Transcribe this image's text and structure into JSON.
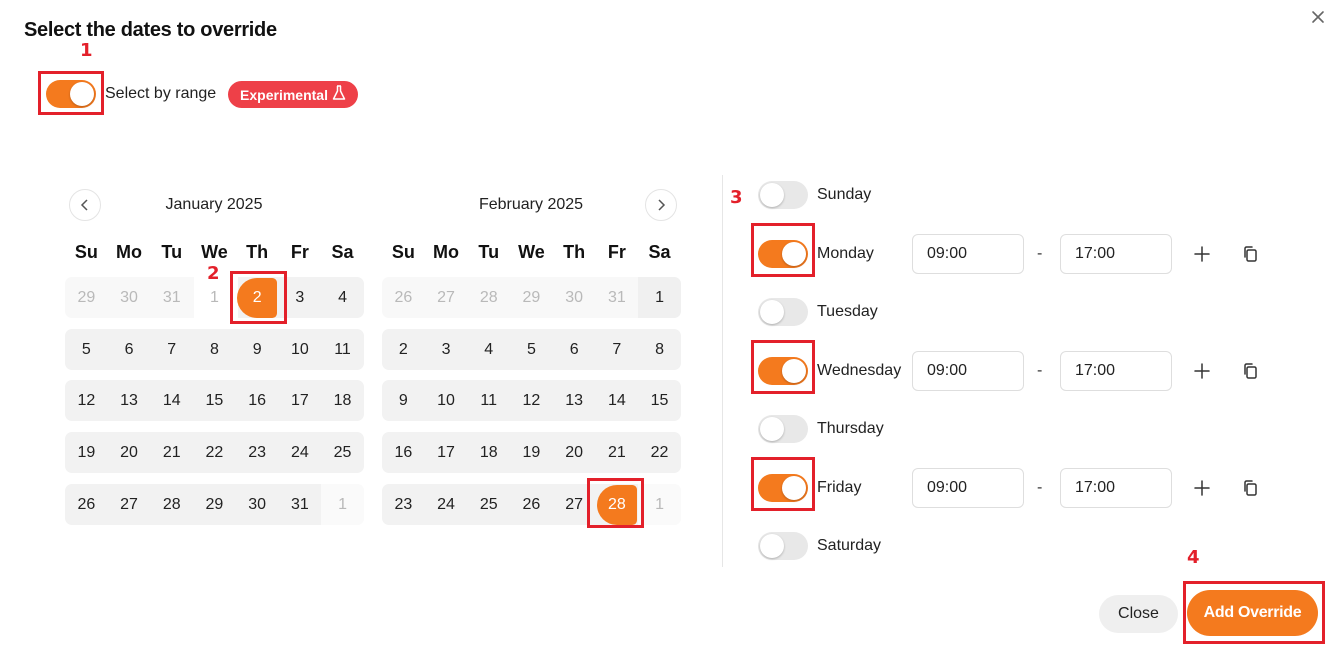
{
  "dialog": {
    "title": "Select the dates to override",
    "close_icon": "close-icon",
    "select_by_range_label": "Select by range",
    "select_by_range_on": true,
    "badge_label": "Experimental",
    "badge_icon": "flask-icon"
  },
  "annotations": [
    "1",
    "2",
    "3",
    "4"
  ],
  "calendar": {
    "weekdays": [
      "Su",
      "Mo",
      "Tu",
      "We",
      "Th",
      "Fr",
      "Sa"
    ],
    "months": [
      {
        "title": "January 2025",
        "weeks": [
          [
            "29",
            "30",
            "31",
            "1",
            "2",
            "3",
            "4"
          ],
          [
            "5",
            "6",
            "7",
            "8",
            "9",
            "10",
            "11"
          ],
          [
            "12",
            "13",
            "14",
            "15",
            "16",
            "17",
            "18"
          ],
          [
            "19",
            "20",
            "21",
            "22",
            "23",
            "24",
            "25"
          ],
          [
            "26",
            "27",
            "28",
            "29",
            "30",
            "31",
            "1"
          ]
        ],
        "selected_day": "2"
      },
      {
        "title": "February 2025",
        "weeks": [
          [
            "26",
            "27",
            "28",
            "29",
            "30",
            "31",
            "1"
          ],
          [
            "2",
            "3",
            "4",
            "5",
            "6",
            "7",
            "8"
          ],
          [
            "9",
            "10",
            "11",
            "12",
            "13",
            "14",
            "15"
          ],
          [
            "16",
            "17",
            "18",
            "19",
            "20",
            "21",
            "22"
          ],
          [
            "23",
            "24",
            "25",
            "26",
            "27",
            "28",
            "1"
          ]
        ],
        "selected_day": "28"
      }
    ]
  },
  "schedule": {
    "days": [
      {
        "name": "Sunday",
        "enabled": false
      },
      {
        "name": "Monday",
        "enabled": true,
        "start": "09:00",
        "end": "17:00"
      },
      {
        "name": "Tuesday",
        "enabled": false
      },
      {
        "name": "Wednesday",
        "enabled": true,
        "start": "09:00",
        "end": "17:00"
      },
      {
        "name": "Thursday",
        "enabled": false
      },
      {
        "name": "Friday",
        "enabled": true,
        "start": "09:00",
        "end": "17:00"
      },
      {
        "name": "Saturday",
        "enabled": false
      }
    ],
    "separator": "-"
  },
  "footer": {
    "close_label": "Close",
    "add_label": "Add Override"
  },
  "colors": {
    "accent": "#f47a1e",
    "badge": "#ee4048",
    "annotation": "#e3202a"
  }
}
